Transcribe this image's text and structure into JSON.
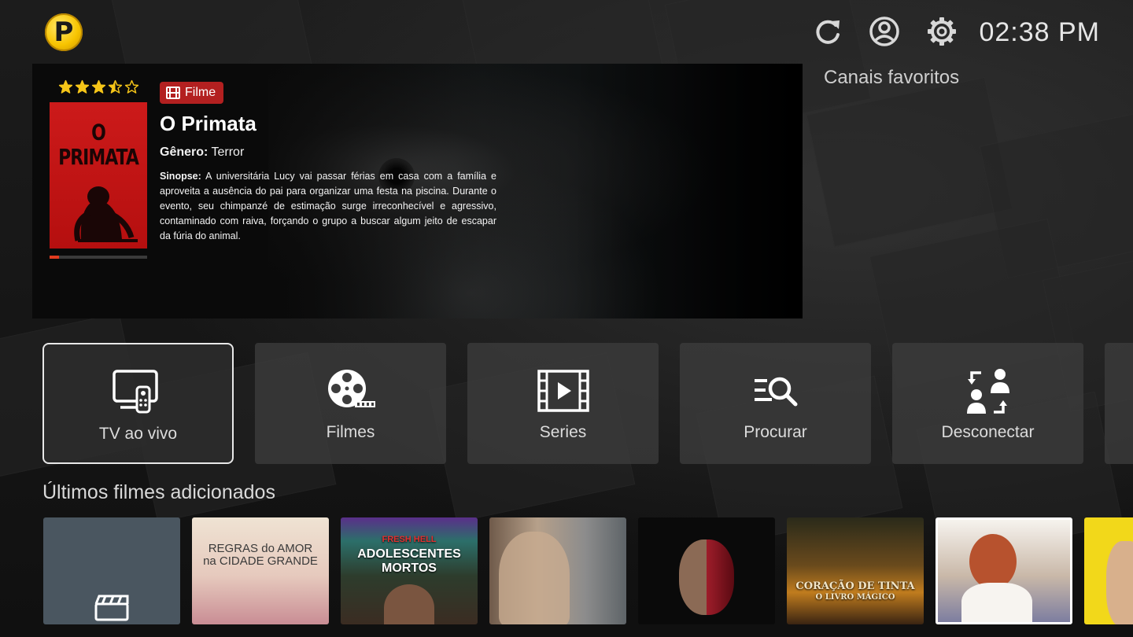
{
  "header": {
    "logo_letter": "P",
    "icons": [
      "refresh-icon",
      "user-account-icon",
      "settings-gear-icon"
    ],
    "clock": "02:38 PM"
  },
  "favorites": {
    "label": "Canais favoritos"
  },
  "featured": {
    "rating": 3.5,
    "max_rating": 5,
    "type_badge": "Filme",
    "title": "O Primata",
    "genre_label": "Gênero:",
    "genre": "Terror",
    "synopsis_label": "Sinopse:",
    "synopsis": "A universitária Lucy vai passar férias em casa com a família e aproveita a ausência do pai para organizar uma festa na piscina. Durante o evento, seu chimpanzé de estimação surge irreconhecível e agressivo, contaminado com raiva, forçando o grupo a buscar algum jeito de escapar da fúria do animal.",
    "poster_title": "O PRIMATA",
    "progress": 0.1,
    "colors": {
      "badge": "#b32020",
      "poster": "#cc1a1a",
      "star": "#f5c518"
    }
  },
  "menu": {
    "items": [
      {
        "label": "TV ao vivo",
        "icon": "tv-remote-icon",
        "active": true
      },
      {
        "label": "Filmes",
        "icon": "film-reel-icon",
        "active": false
      },
      {
        "label": "Series",
        "icon": "video-play-icon",
        "active": false
      },
      {
        "label": "Procurar",
        "icon": "search-list-icon",
        "active": false
      },
      {
        "label": "Desconectar",
        "icon": "switch-user-icon",
        "active": false
      }
    ]
  },
  "latest": {
    "title": "Últimos filmes adicionados",
    "items": [
      {
        "text": ""
      },
      {
        "text": "REGRAS do AMOR na CIDADE GRANDE"
      },
      {
        "text": "ADOLESCENTES MORTOS",
        "tag": "FRESH HELL"
      },
      {
        "text": ""
      },
      {
        "text": ""
      },
      {
        "text": "CORAÇÃO DE TINTA",
        "subtitle": "O LIVRO MÁGICO"
      },
      {
        "text": ""
      },
      {
        "text": ""
      }
    ]
  }
}
